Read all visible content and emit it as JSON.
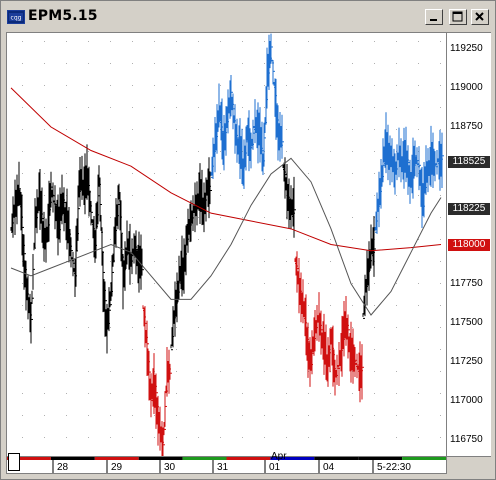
{
  "window": {
    "title": "EPM5.15"
  },
  "icons": {
    "app": "cqg-app-icon",
    "minimize": "minimize-icon",
    "maximize": "maximize-icon",
    "close": "close-icon"
  },
  "colors": {
    "up_bar": "#1e6fd0",
    "down_bar": "#d01010",
    "neutral_bar": "#000000",
    "ma_long": "#c00000",
    "ma_short": "#555555",
    "bg": "#ffffff"
  },
  "chart_data": {
    "type": "bar",
    "description_free": true,
    "ylim": [
      116650,
      119350
    ],
    "y_ticks": [
      "119250",
      "119000",
      "118750",
      "118525",
      "118225",
      "118000",
      "117750",
      "117500",
      "117250",
      "117000",
      "116750"
    ],
    "price_tags": [
      {
        "label": "118525",
        "value": 118525,
        "color": "#2b2b2b"
      },
      {
        "label": "118225",
        "value": 118225,
        "color": "#2b2b2b"
      },
      {
        "label": "118000",
        "value": 118000,
        "color": "#d01010"
      }
    ],
    "x_labels": [
      "28",
      "29",
      "30",
      "31",
      "01",
      "04",
      "5-22:30"
    ],
    "x_top_label": "Apr",
    "session_bar_colors": [
      "#d01010",
      "#000000",
      "#d01010",
      "#000000",
      "#1e9a1e",
      "#d01010",
      "#0000c0",
      "#000000",
      "#000000",
      "#1e9a1e"
    ],
    "segments": [
      {
        "color": "#000000",
        "points": [
          [
            0,
            118100
          ],
          [
            4,
            118250
          ],
          [
            8,
            118350
          ],
          [
            12,
            118000
          ],
          [
            16,
            117700
          ],
          [
            20,
            117500
          ],
          [
            24,
            118150
          ],
          [
            28,
            118300
          ],
          [
            32,
            118100
          ],
          [
            36,
            118050
          ],
          [
            40,
            118350
          ],
          [
            44,
            118250
          ],
          [
            48,
            118100
          ],
          [
            52,
            118300
          ],
          [
            56,
            118150
          ],
          [
            60,
            117950
          ],
          [
            64,
            117800
          ],
          [
            68,
            118350
          ],
          [
            72,
            118400
          ],
          [
            76,
            118450
          ],
          [
            80,
            118200
          ],
          [
            84,
            118000
          ],
          [
            88,
            118400
          ],
          [
            92,
            117800
          ],
          [
            96,
            117450
          ],
          [
            100,
            117700
          ],
          [
            104,
            118100
          ],
          [
            108,
            118300
          ],
          [
            112,
            117800
          ],
          [
            116,
            118000
          ],
          [
            120,
            117900
          ],
          [
            124,
            118000
          ],
          [
            128,
            117850
          ]
        ]
      },
      {
        "color": "#d01010",
        "points": [
          [
            132,
            117600
          ],
          [
            136,
            117350
          ],
          [
            140,
            117000
          ],
          [
            144,
            117100
          ],
          [
            148,
            116850
          ],
          [
            152,
            116700
          ],
          [
            156,
            117200
          ]
        ]
      },
      {
        "color": "#000000",
        "points": [
          [
            160,
            117350
          ],
          [
            164,
            117600
          ],
          [
            168,
            117750
          ],
          [
            172,
            117850
          ],
          [
            176,
            118050
          ],
          [
            180,
            118150
          ],
          [
            184,
            118250
          ],
          [
            188,
            118300
          ],
          [
            192,
            118250
          ],
          [
            196,
            118350
          ]
        ]
      },
      {
        "color": "#1e6fd0",
        "points": [
          [
            200,
            118450
          ],
          [
            204,
            118650
          ],
          [
            208,
            118850
          ],
          [
            212,
            118650
          ],
          [
            216,
            118800
          ],
          [
            220,
            118950
          ],
          [
            224,
            118750
          ],
          [
            228,
            118600
          ],
          [
            232,
            118500
          ],
          [
            236,
            118700
          ],
          [
            240,
            118600
          ],
          [
            244,
            118800
          ],
          [
            248,
            118700
          ],
          [
            252,
            118550
          ],
          [
            256,
            119050
          ],
          [
            260,
            119250
          ],
          [
            264,
            118950
          ],
          [
            268,
            118650
          ]
        ]
      },
      {
        "color": "#000000",
        "points": [
          [
            272,
            118500
          ],
          [
            276,
            118350
          ],
          [
            280,
            118200
          ]
        ]
      },
      {
        "color": "#d01010",
        "points": [
          [
            284,
            117900
          ],
          [
            288,
            117750
          ],
          [
            292,
            117600
          ],
          [
            296,
            117400
          ],
          [
            300,
            117250
          ],
          [
            304,
            117450
          ],
          [
            308,
            117550
          ],
          [
            312,
            117350
          ],
          [
            316,
            117250
          ],
          [
            320,
            117400
          ],
          [
            324,
            117150
          ],
          [
            328,
            117250
          ],
          [
            332,
            117400
          ],
          [
            336,
            117500
          ],
          [
            340,
            117300
          ],
          [
            344,
            117250
          ],
          [
            348,
            117200
          ]
        ]
      },
      {
        "color": "#000000",
        "points": [
          [
            352,
            117550
          ],
          [
            356,
            117800
          ],
          [
            360,
            117950
          ]
        ]
      },
      {
        "color": "#1e6fd0",
        "points": [
          [
            364,
            118100
          ],
          [
            368,
            118300
          ],
          [
            372,
            118500
          ],
          [
            376,
            118650
          ],
          [
            380,
            118550
          ],
          [
            384,
            118450
          ],
          [
            388,
            118600
          ],
          [
            392,
            118500
          ],
          [
            396,
            118550
          ],
          [
            400,
            118400
          ],
          [
            404,
            118550
          ],
          [
            408,
            118500
          ],
          [
            412,
            118250
          ],
          [
            416,
            118500
          ],
          [
            420,
            118550
          ],
          [
            424,
            118500
          ],
          [
            428,
            118550
          ]
        ]
      }
    ],
    "ma_long": [
      [
        0,
        119000
      ],
      [
        40,
        118750
      ],
      [
        80,
        118600
      ],
      [
        120,
        118500
      ],
      [
        160,
        118330
      ],
      [
        200,
        118200
      ],
      [
        240,
        118150
      ],
      [
        280,
        118100
      ],
      [
        320,
        118000
      ],
      [
        360,
        117960
      ],
      [
        400,
        117980
      ],
      [
        430,
        118000
      ]
    ],
    "ma_short": [
      [
        0,
        117850
      ],
      [
        20,
        117800
      ],
      [
        40,
        117850
      ],
      [
        60,
        117900
      ],
      [
        80,
        117950
      ],
      [
        100,
        118000
      ],
      [
        120,
        117950
      ],
      [
        140,
        117800
      ],
      [
        160,
        117650
      ],
      [
        180,
        117650
      ],
      [
        200,
        117800
      ],
      [
        220,
        118000
      ],
      [
        240,
        118250
      ],
      [
        260,
        118450
      ],
      [
        280,
        118550
      ],
      [
        300,
        118400
      ],
      [
        320,
        118100
      ],
      [
        340,
        117750
      ],
      [
        360,
        117550
      ],
      [
        380,
        117700
      ],
      [
        400,
        117950
      ],
      [
        420,
        118200
      ],
      [
        430,
        118300
      ]
    ]
  }
}
